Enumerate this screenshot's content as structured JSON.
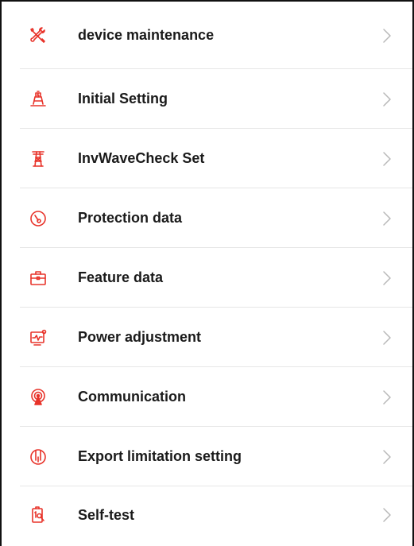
{
  "colors": {
    "accent": "#e8332a",
    "text": "#1a1a1a",
    "chevron": "#b8b8b8",
    "divider": "#e6e6e6"
  },
  "menu": {
    "items": [
      {
        "label": "device maintenance",
        "icon": "wrench-screwdriver-icon"
      },
      {
        "label": "Initial Setting",
        "icon": "solar-tower-icon"
      },
      {
        "label": "InvWaveCheck Set",
        "icon": "power-pylon-icon"
      },
      {
        "label": "Protection data",
        "icon": "gauge-circle-icon"
      },
      {
        "label": "Feature data",
        "icon": "toolbox-icon"
      },
      {
        "label": "Power adjustment",
        "icon": "monitor-wave-icon"
      },
      {
        "label": "Communication",
        "icon": "signal-broadcast-icon"
      },
      {
        "label": "Export limitation setting",
        "icon": "meter-dial-icon"
      },
      {
        "label": "Self-test",
        "icon": "battery-search-icon"
      }
    ]
  }
}
